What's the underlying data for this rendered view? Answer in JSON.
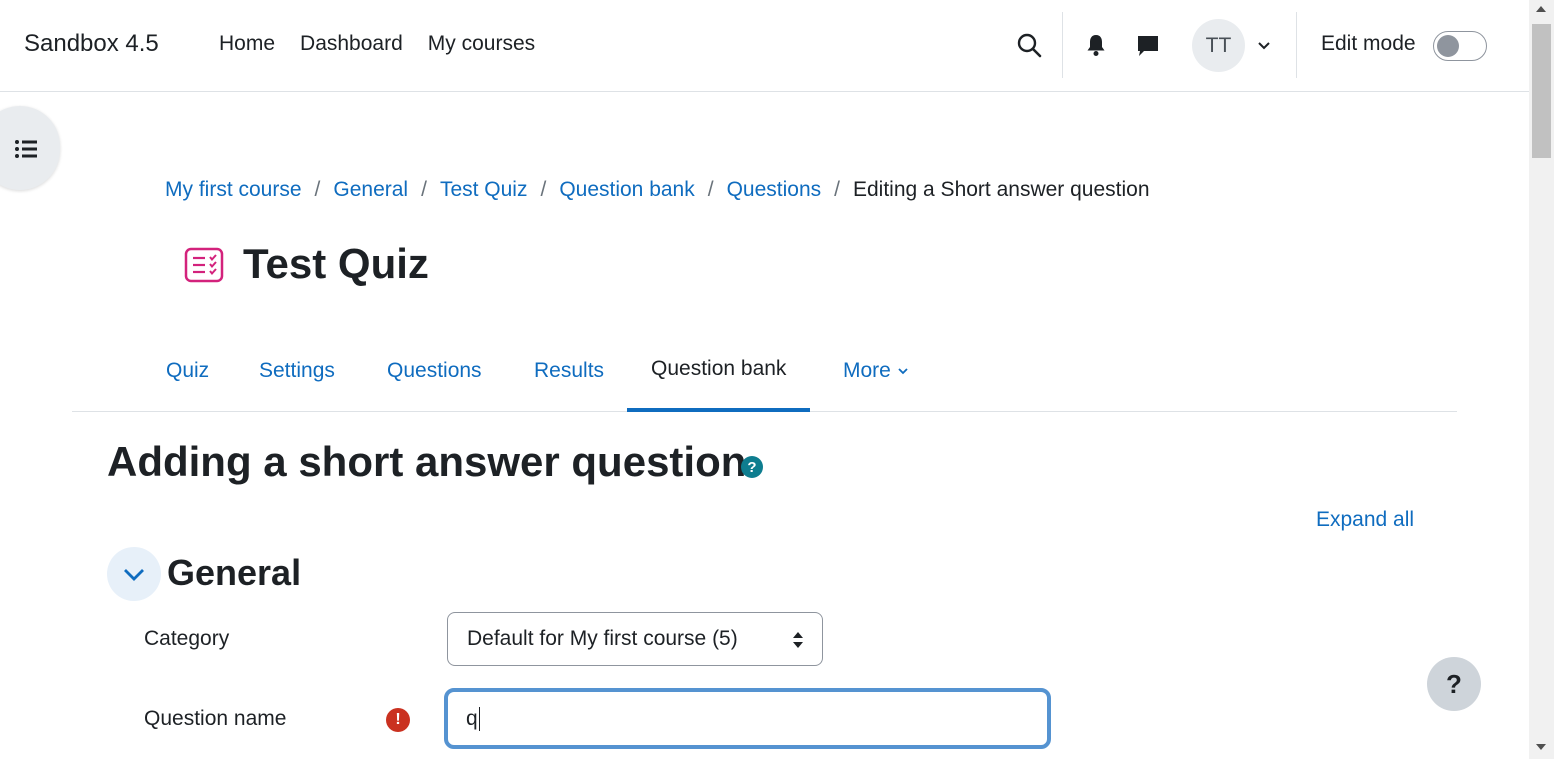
{
  "navbar": {
    "brand": "Sandbox 4.5",
    "links": [
      "Home",
      "Dashboard",
      "My courses"
    ],
    "avatar_initials": "TT",
    "edit_mode_label": "Edit mode",
    "edit_mode_on": false
  },
  "breadcrumb": {
    "links": [
      "My first course",
      "General",
      "Test Quiz",
      "Question bank",
      "Questions"
    ],
    "current": "Editing a Short answer question",
    "separator": "/"
  },
  "page": {
    "title": "Test Quiz",
    "icon": "quiz-icon"
  },
  "secondary_nav": {
    "tabs": [
      "Quiz",
      "Settings",
      "Questions",
      "Results",
      "Question bank",
      "More"
    ],
    "active": "Question bank"
  },
  "form": {
    "heading": "Adding a short answer question",
    "help_glyph": "?",
    "expand_all": "Expand all",
    "section_title": "General",
    "category_label": "Category",
    "category_value": "Default for My first course (5)",
    "question_name_label": "Question name",
    "required_glyph": "!",
    "question_name_value": "q"
  },
  "floating_help_glyph": "?",
  "colors": {
    "link": "#0f6cbf",
    "text": "#1d2125",
    "focus_border": "#5593d1",
    "required": "#ca3120",
    "help": "#0e7d8f"
  }
}
